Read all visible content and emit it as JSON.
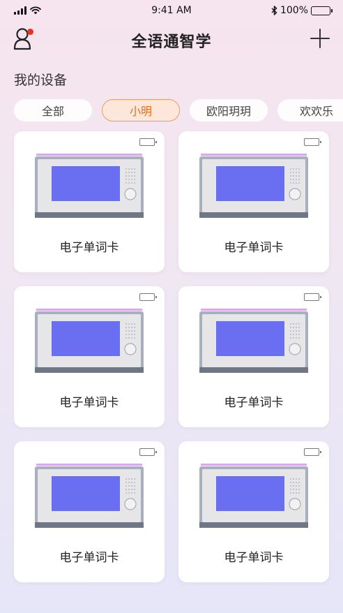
{
  "status_bar": {
    "time": "9:41 AM",
    "battery": "100%"
  },
  "header": {
    "title": "全语通智学"
  },
  "section_title": "我的设备",
  "tabs": [
    {
      "label": "全部",
      "active": false
    },
    {
      "label": "小明",
      "active": true
    },
    {
      "label": "欧阳玥玥",
      "active": false
    },
    {
      "label": "欢欢乐",
      "active": false
    }
  ],
  "devices": [
    {
      "name": "电子单词卡"
    },
    {
      "name": "电子单词卡"
    },
    {
      "name": "电子单词卡"
    },
    {
      "name": "电子单词卡"
    },
    {
      "name": "电子单词卡"
    },
    {
      "name": "电子单词卡"
    }
  ],
  "colors": {
    "accent": "#e07120",
    "accent_border": "#f09a5e",
    "badge": "#e8321f",
    "screen": "#6a6ef0"
  }
}
